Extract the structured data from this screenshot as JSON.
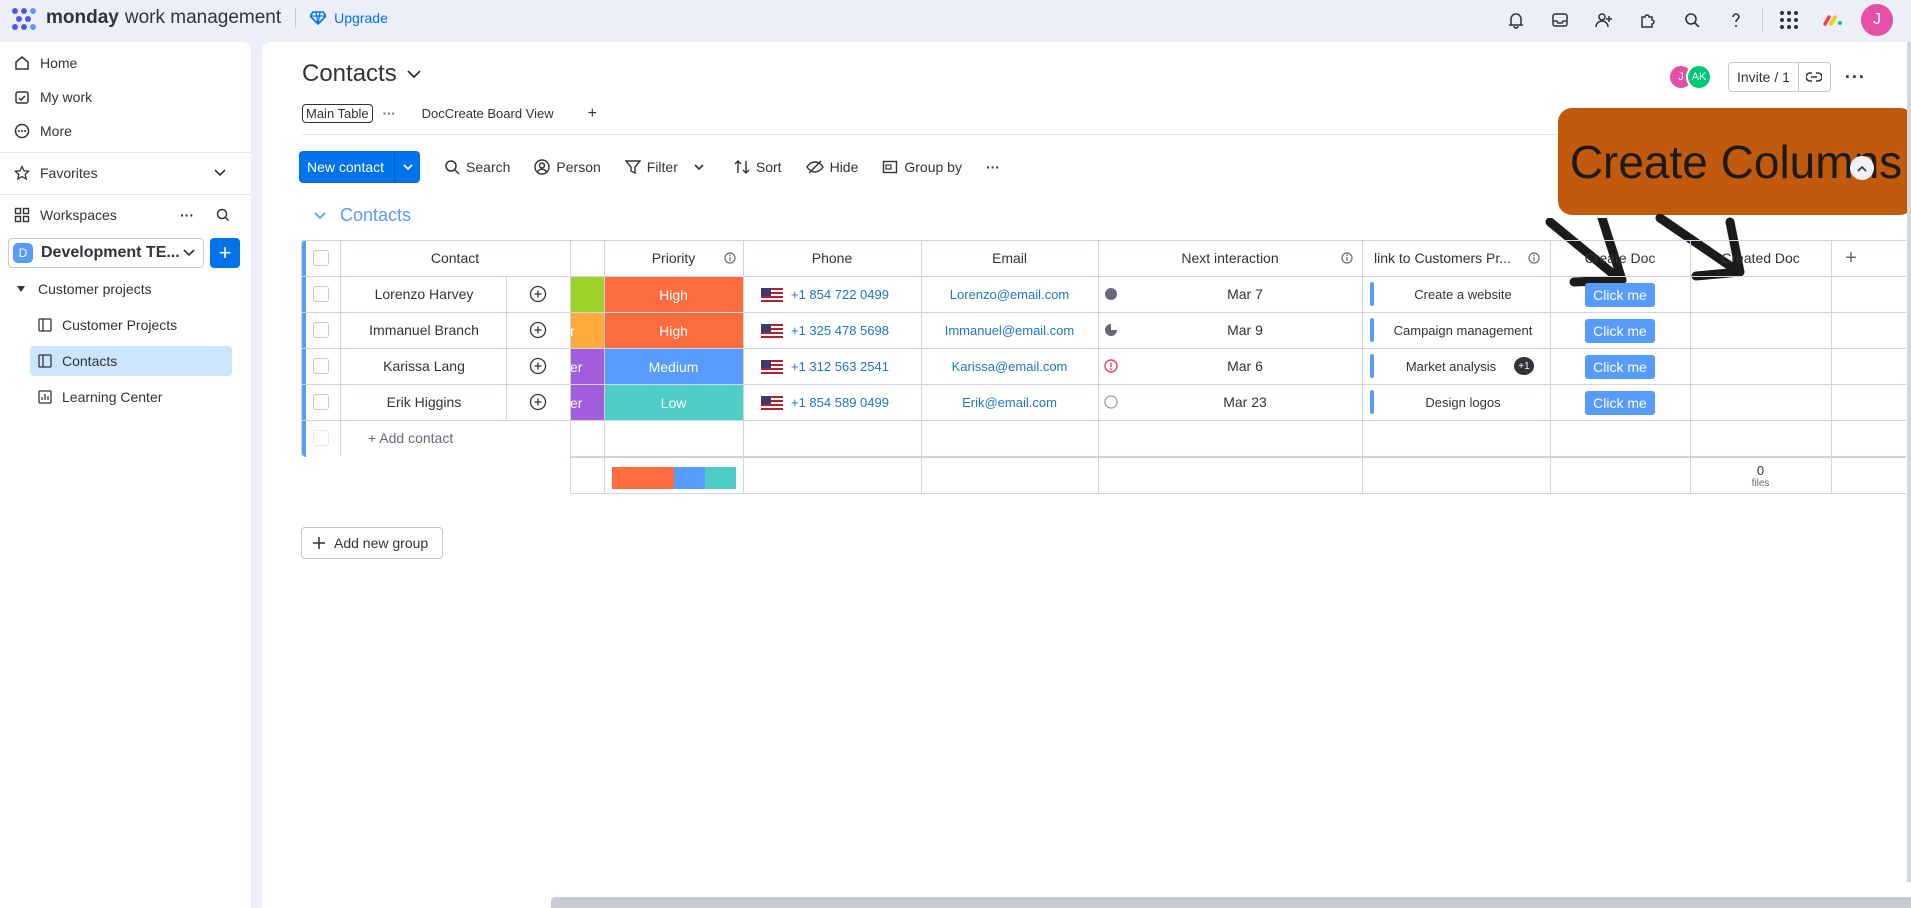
{
  "topbar": {
    "brand": "monday",
    "brand_sub": "work management",
    "upgrade": "Upgrade",
    "user_initial": "J"
  },
  "sidebar": {
    "nav": [
      {
        "label": "Home",
        "icon": "home-icon"
      },
      {
        "label": "My work",
        "icon": "my-work-icon"
      },
      {
        "label": "More",
        "icon": "more-circle-icon"
      }
    ],
    "favorites": "Favorites",
    "workspaces": "Workspaces",
    "workspace_badge": "D",
    "workspace_name": "Development TE...",
    "folder": "Customer projects",
    "boards": [
      {
        "label": "Customer Projects",
        "icon": "board-icon"
      },
      {
        "label": "Contacts",
        "icon": "board-icon",
        "active": true
      },
      {
        "label": "Learning Center",
        "icon": "dashboard-icon"
      }
    ]
  },
  "board": {
    "title": "Contacts",
    "tabs": [
      "Main Table",
      "DocCreate Board View"
    ],
    "tab_more": "···",
    "tab_add": "+",
    "avatars": [
      {
        "initials": "J",
        "color": "#e44fa8"
      },
      {
        "initials": "AK",
        "color": "#00c875"
      }
    ],
    "invite": "Invite / 1",
    "more": "···"
  },
  "callout": {
    "text": "Create Columns",
    "color": "#c25a0e"
  },
  "toolbar": {
    "new_contact": "New contact",
    "search": "Search",
    "person": "Person",
    "filter": "Filter",
    "sort": "Sort",
    "hide": "Hide",
    "group_by": "Group by",
    "more": "···"
  },
  "group": {
    "title": "Contacts",
    "color": "#579bfc",
    "columns": {
      "contact": "Contact",
      "priority": "Priority",
      "phone": "Phone",
      "email": "Email",
      "next_interaction": "Next interaction",
      "link": "link to Customers Pr...",
      "create_doc": "Create Doc",
      "created_doc": "Created Doc"
    },
    "rows": [
      {
        "name": "Lorenzo Harvey",
        "type_text": "",
        "type_color": "#9cd326",
        "priority": "High",
        "priority_color": "#fd6c3f",
        "phone": "+1 854 722 0499",
        "email": "Lorenzo@email.com",
        "next": "Mar 7",
        "link": "Create a website",
        "link_extra": "",
        "create": "Click me"
      },
      {
        "name": "Immanuel Branch",
        "type_text": "r",
        "type_color": "#fdab3d",
        "priority": "High",
        "priority_color": "#fd6c3f",
        "phone": "+1 325 478 5698",
        "email": "Immanuel@email.com",
        "next": "Mar 9",
        "link": "Campaign management",
        "link_extra": "",
        "create": "Click me"
      },
      {
        "name": "Karissa Lang",
        "type_text": "er",
        "type_color": "#a25ddc",
        "priority": "Medium",
        "priority_color": "#579bfc",
        "phone": "+1 312 563 2541",
        "email": "Karissa@email.com",
        "next": "Mar 6",
        "link": "Market analysis",
        "link_extra": "+1",
        "create": "Click me"
      },
      {
        "name": "Erik Higgins",
        "type_text": "er",
        "type_color": "#a25ddc",
        "priority": "Low",
        "priority_color": "#4eccc6",
        "phone": "+1 854 589 0499",
        "email": "Erik@email.com",
        "next": "Mar 23",
        "link": "Design logos",
        "link_extra": "",
        "create": "Click me"
      }
    ],
    "add_row": "+ Add contact",
    "summary_files_count": "0",
    "summary_files_label": "files",
    "priority_summary": [
      {
        "color": "#fd6c3f",
        "fraction": 0.5
      },
      {
        "color": "#579bfc",
        "fraction": 0.25
      },
      {
        "color": "#4eccc6",
        "fraction": 0.25
      }
    ]
  },
  "add_group": "Add new group"
}
